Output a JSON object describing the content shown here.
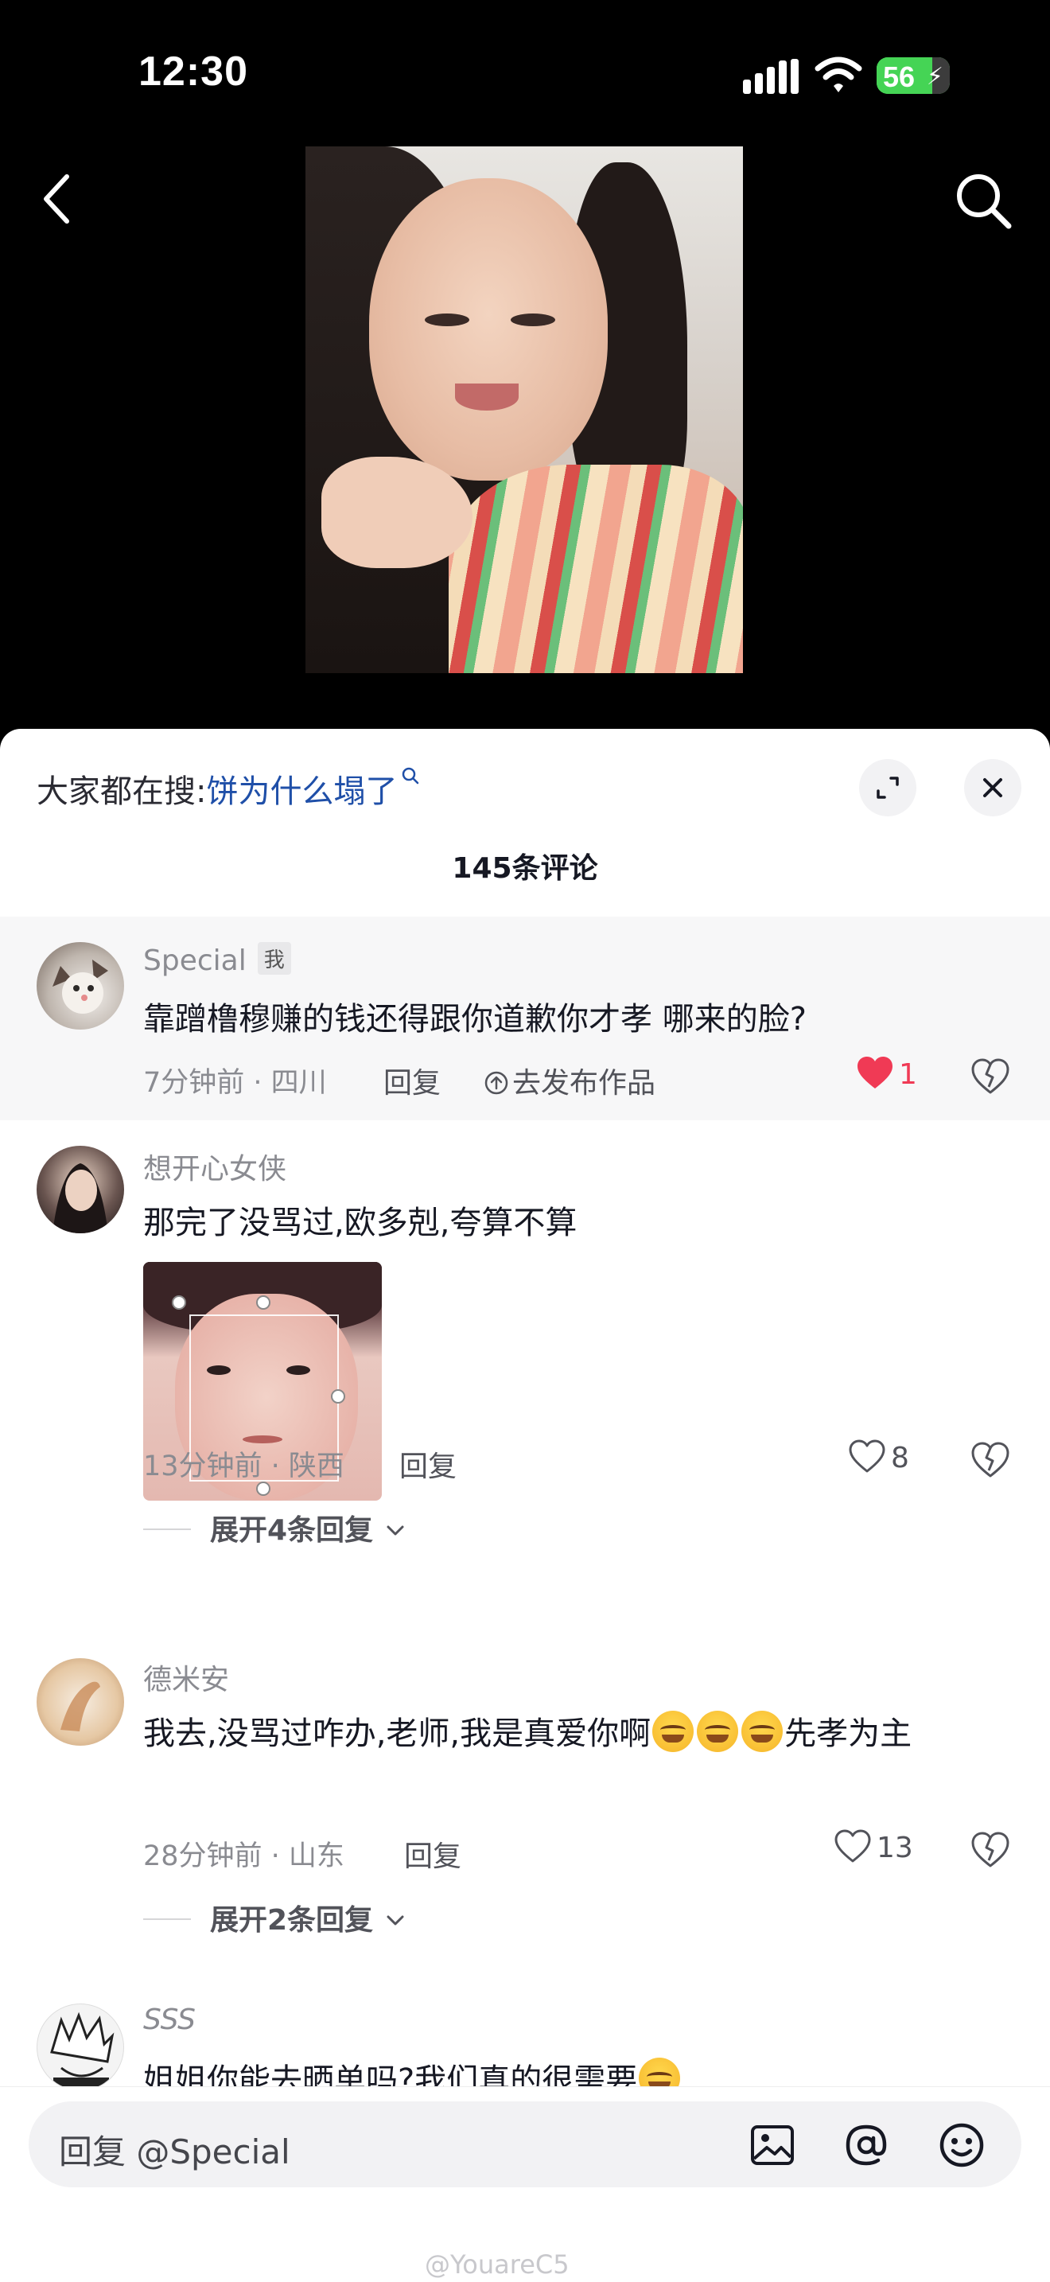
{
  "status_bar": {
    "time": "12:30",
    "battery_level": "56"
  },
  "suggest": {
    "prefix": "大家都在搜:",
    "term": "饼为什么塌了"
  },
  "comment_count": "145条评论",
  "comments": [
    {
      "name": "Special",
      "badge": "我",
      "text": "靠蹭橹穆赚的钱还得跟你道歉你才孝 哪来的脸?",
      "meta": "7分钟前 · 四川",
      "reply": "回复",
      "publish": "去发布作品",
      "likes": "1",
      "liked": true
    },
    {
      "name": "想开心女侠",
      "text": "那完了没骂过,欧多剋,夸算不算",
      "meta": "13分钟前 · 陕西",
      "reply": "回复",
      "likes": "8",
      "expand": "展开4条回复"
    },
    {
      "name": "德米安",
      "text_a": "我去,没骂过咋办,老师,我是真爱你啊",
      "text_b": "先孝为主",
      "meta": "28分钟前 · 山东",
      "reply": "回复",
      "likes": "13",
      "expand": "展开2条回复"
    },
    {
      "name": "SSS",
      "text": "姐姐你能去晒单吗?我们真的很需要"
    }
  ],
  "reply_bar": {
    "placeholder": "回复 @Special"
  },
  "watermark": "@YouareC5",
  "colors": {
    "like_active": "#f03a55",
    "link": "#1f4fa8",
    "battery": "#45d455"
  }
}
